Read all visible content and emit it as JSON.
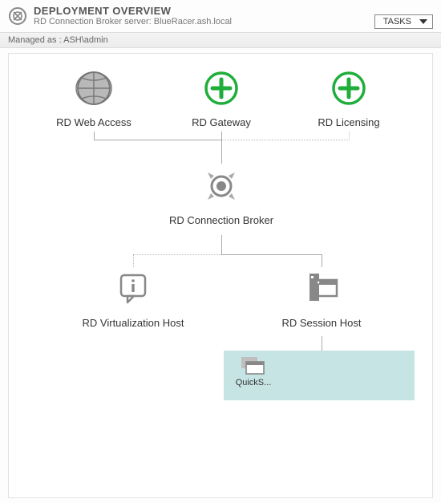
{
  "header": {
    "title": "DEPLOYMENT OVERVIEW",
    "subtitle": "RD Connection Broker server: BlueRacer.ash.local",
    "tasks_label": "TASKS"
  },
  "managed_bar": "Managed as : ASH\\admin",
  "nodes": {
    "web_access": "RD Web Access",
    "gateway": "RD Gateway",
    "licensing": "RD Licensing",
    "broker": "RD Connection Broker",
    "virt_host": "RD Virtualization Host",
    "session_host": "RD Session Host"
  },
  "collection": {
    "item_label": "QuickS..."
  }
}
